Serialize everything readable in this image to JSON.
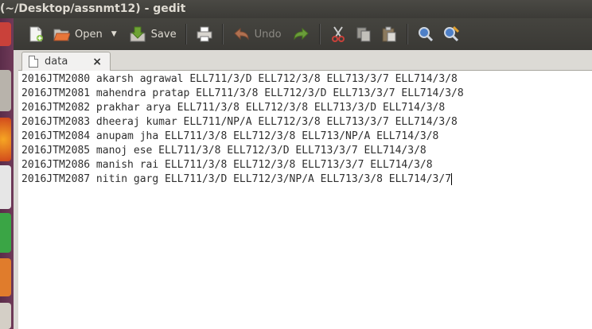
{
  "window": {
    "title": "(~/Desktop/assnmt12) - gedit"
  },
  "toolbar": {
    "open_label": "Open",
    "save_label": "Save",
    "undo_label": "Undo"
  },
  "tab": {
    "label": "data",
    "close": "×"
  },
  "editor": {
    "lines": [
      "2016JTM2080 akarsh agrawal ELL711/3/D ELL712/3/8 ELL713/3/7 ELL714/3/8",
      "2016JTM2081 mahendra pratap ELL711/3/8 ELL712/3/D ELL713/3/7 ELL714/3/8",
      "2016JTM2082 prakhar arya ELL711/3/8 ELL712/3/8 ELL713/3/D ELL714/3/8",
      "2016JTM2083 dheeraj kumar ELL711/NP/A ELL712/3/8 ELL713/3/7 ELL714/3/8",
      "2016JTM2084 anupam jha ELL711/3/8 ELL712/3/8 ELL713/NP/A ELL714/3/8",
      "2016JTM2085 manoj ese ELL711/3/8 ELL712/3/D ELL713/3/7 ELL714/3/8",
      "2016JTM2086 manish rai ELL711/3/8 ELL712/3/8 ELL713/3/7 ELL714/3/8",
      "2016JTM2087 nitin garg ELL711/3/D ELL712/3/NP/A ELL713/3/8 ELL714/3/7"
    ]
  },
  "icons": {
    "new": "new-document-icon",
    "open": "folder-open-icon",
    "save": "save-icon",
    "print": "print-icon",
    "undo": "undo-icon",
    "redo": "redo-icon",
    "cut": "cut-icon",
    "copy": "copy-icon",
    "paste": "paste-icon",
    "find": "search-icon",
    "replace": "find-replace-icon"
  }
}
